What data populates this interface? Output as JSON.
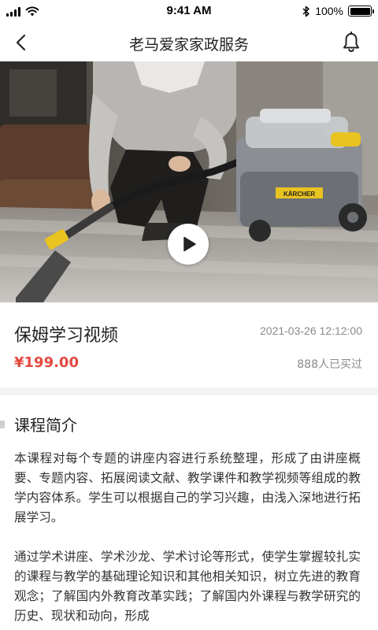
{
  "status_bar": {
    "time": "9:41 AM",
    "battery_percent": "100%",
    "battery_level": 1.0
  },
  "nav": {
    "title": "老马爱家家政服务"
  },
  "video": {
    "brand_text": "KÄRCHER",
    "accent_color": "#e9c31f"
  },
  "course": {
    "title": "保姆学习视频",
    "datetime": "2021-03-26 12:12:00",
    "price": "¥199.00",
    "buyers": "888人已买过",
    "price_color": "#e5483f"
  },
  "intro": {
    "heading": "课程简介",
    "paragraphs": [
      "本课程对每个专题的讲座内容进行系统整理，形成了由讲座概要、专题内容、拓展阅读文献、教学课件和教学视频等组成的教学内容体系。学生可以根据自己的学习兴趣，由浅入深地进行拓展学习。",
      "通过学术讲座、学术沙龙、学术讨论等形式，使学生掌握较扎实的课程与教学的基础理论知识和其他相关知识，树立先进的教育观念；了解国内外教育改革实践；了解国内外课程与教学研究的历史、现状和动向，形成"
    ]
  }
}
